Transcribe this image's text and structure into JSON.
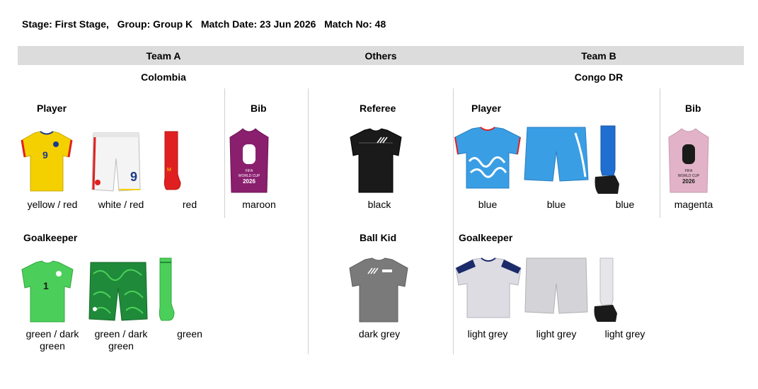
{
  "header": {
    "stage": "Stage: First Stage,",
    "group": "Group: Group K",
    "match_date": "Match Date: 23 Jun 2026",
    "match_no": "Match No: 48"
  },
  "columns": {
    "team_a": "Team A",
    "others": "Others",
    "team_b": "Team B"
  },
  "team_a": {
    "name": "Colombia",
    "player_title": "Player",
    "bib_title": "Bib",
    "goalkeeper_title": "Goalkeeper",
    "player": {
      "shirt": "yellow / red",
      "shorts": "white / red",
      "socks": "red"
    },
    "bib": "maroon",
    "goalkeeper": {
      "shirt": "green / dark green",
      "shorts": "green / dark green",
      "socks": "green"
    }
  },
  "others": {
    "referee_title": "Referee",
    "referee": "black",
    "ball_kid_title": "Ball Kid",
    "ball_kid": "dark grey"
  },
  "team_b": {
    "name": "Congo DR",
    "player_title": "Player",
    "bib_title": "Bib",
    "goalkeeper_title": "Goalkeeper",
    "player": {
      "shirt": "blue",
      "shorts": "blue",
      "socks": "blue"
    },
    "bib": "magenta",
    "goalkeeper": {
      "shirt": "light grey",
      "shorts": "light grey",
      "socks": "light grey"
    }
  },
  "colors": {
    "yellow": "#f5d000",
    "red": "#e02020",
    "white": "#f4f4f4",
    "maroon": "#8a1f6e",
    "black": "#1a1a1a",
    "dark_grey": "#7a7a7a",
    "green": "#4ccf5a",
    "dark_green": "#1f8a3a",
    "blue": "#3a9ee4",
    "magenta": "#e2b3c8",
    "light_grey": "#d4d4d8"
  }
}
